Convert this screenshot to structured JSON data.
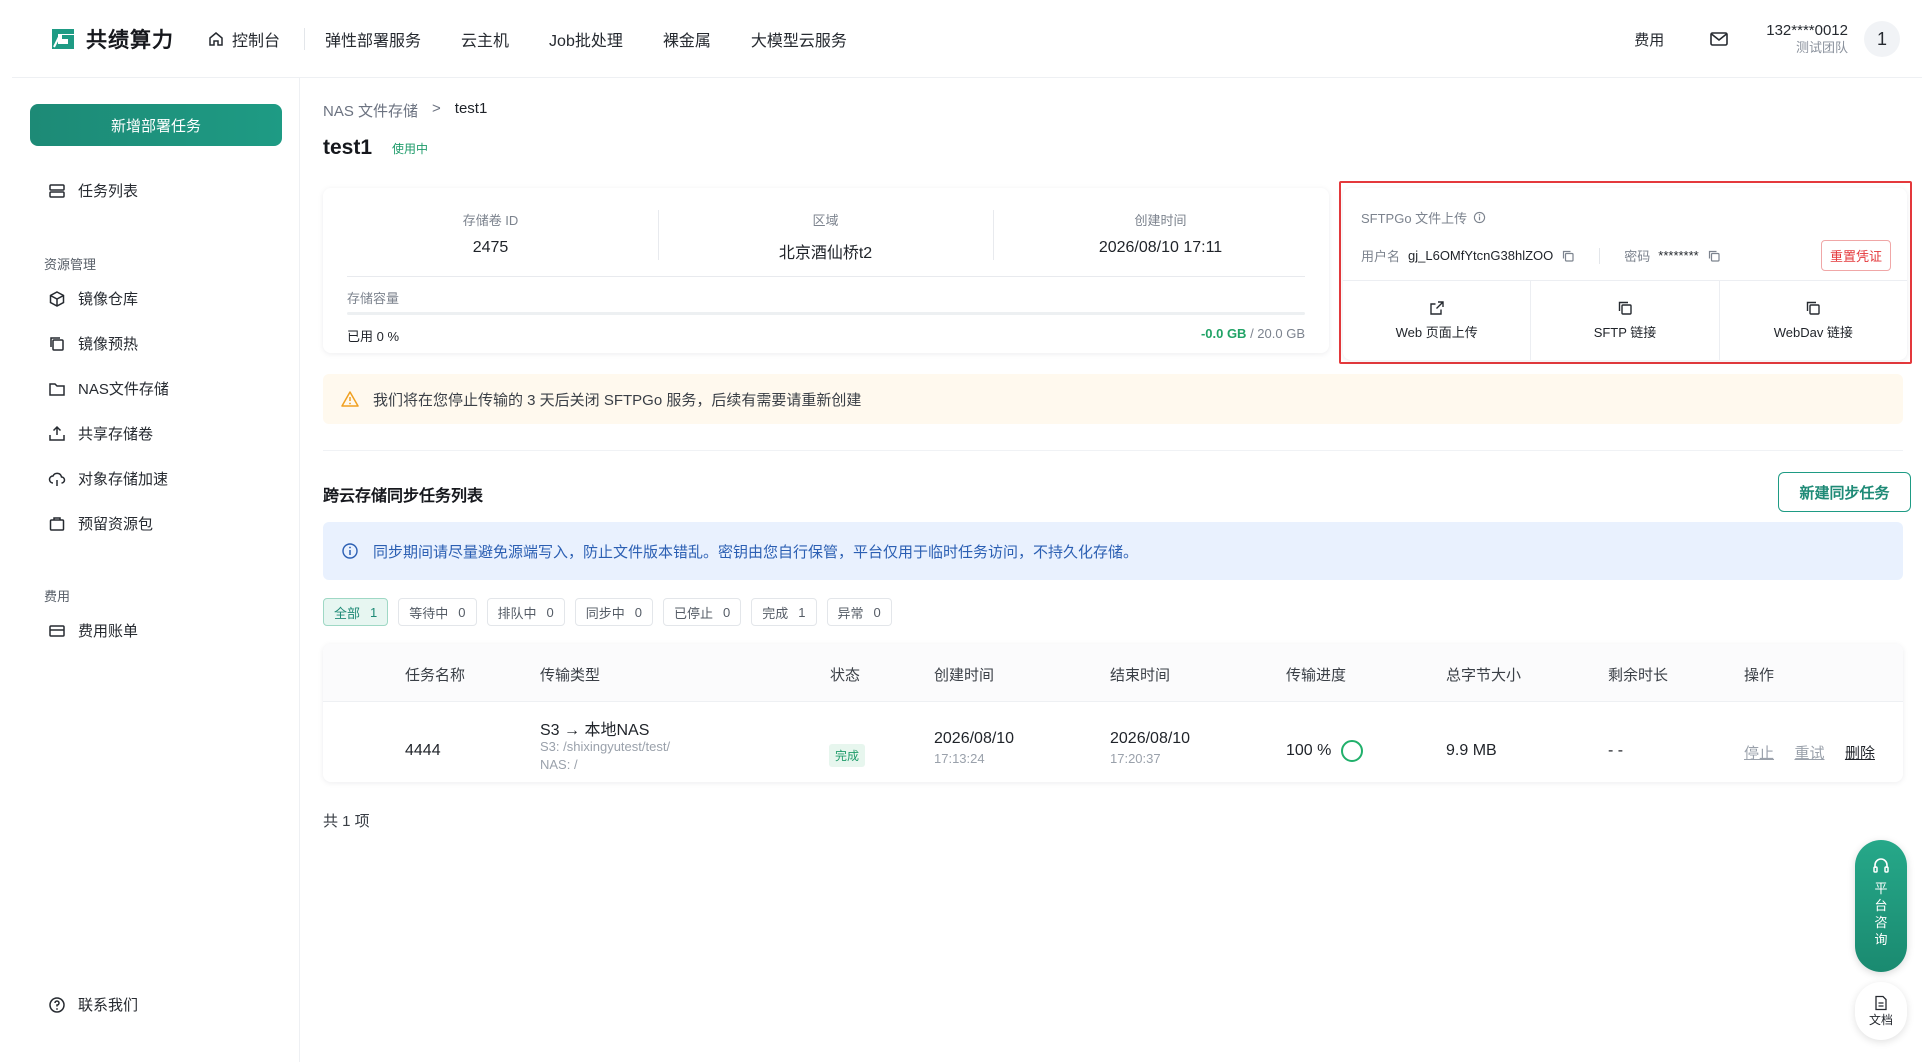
{
  "brand": {
    "name": "共绩算力",
    "accent": "#1e9b84"
  },
  "nav": {
    "console": "控制台",
    "items": [
      "弹性部署服务",
      "云主机",
      "Job批处理",
      "裸金属",
      "大模型云服务"
    ],
    "fee": "费用",
    "user_phone": "132****0012",
    "user_team": "测试团队",
    "avatar": "1"
  },
  "sidebar": {
    "new_task": "新增部署任务",
    "task_list": "任务列表",
    "group_resource": "资源管理",
    "resource_items": [
      "镜像仓库",
      "镜像预热",
      "NAS文件存储",
      "共享存储卷",
      "对象存储加速",
      "预留资源包"
    ],
    "group_fee": "费用",
    "fee_items": [
      "费用账单"
    ],
    "contact": "联系我们"
  },
  "breadcrumb": {
    "parent": "NAS 文件存储",
    "sep": ">",
    "current": "test1"
  },
  "page": {
    "title": "test1",
    "status": "使用中"
  },
  "storage": {
    "id_label": "存储卷 ID",
    "id": "2475",
    "region_label": "区域",
    "region": "北京酒仙桥t2",
    "created_label": "创建时间",
    "created": "2026/08/10 17:11",
    "capacity_label": "存储容量",
    "used": "已用 0 %",
    "used_gb": "-0.0 GB",
    "total_gb": "/ 20.0 GB",
    "used_fraction": 0
  },
  "sftp": {
    "title": "SFTPGo 文件上传",
    "user_label": "用户名",
    "user": "gj_L6OMfYtcnG38hlZOO",
    "pwd_label": "密码",
    "pwd": "********",
    "reset": "重置凭证",
    "actions": [
      "Web 页面上传",
      "SFTP 链接",
      "WebDav 链接"
    ]
  },
  "warning": "我们将在您停止传输的 3 天后关闭 SFTPGo 服务，后续有需要请重新创建",
  "sync": {
    "title": "跨云存储同步任务列表",
    "new_button": "新建同步任务",
    "info": "同步期间请尽量避免源端写入，防止文件版本错乱。密钥由您自行保管，平台仅用于临时任务访问，不持久化存储。",
    "filters": [
      {
        "label": "全部",
        "count": "1"
      },
      {
        "label": "等待中",
        "count": "0"
      },
      {
        "label": "排队中",
        "count": "0"
      },
      {
        "label": "同步中",
        "count": "0"
      },
      {
        "label": "已停止",
        "count": "0"
      },
      {
        "label": "完成",
        "count": "1"
      },
      {
        "label": "异常",
        "count": "0"
      }
    ],
    "columns": [
      "任务名称",
      "传输类型",
      "状态",
      "创建时间",
      "结束时间",
      "传输进度",
      "总字节大小",
      "剩余时长",
      "操作"
    ],
    "rows": [
      {
        "name": "4444",
        "type": "S3 → 本地NAS",
        "src": "S3: /shixingyutest/test/",
        "dst": "NAS: /",
        "status": "完成",
        "created_date": "2026/08/10",
        "created_time": "17:13:24",
        "ended_date": "2026/08/10",
        "ended_time": "17:20:37",
        "progress": "100 %",
        "size": "9.9 MB",
        "remaining": "- -",
        "ops": [
          "停止",
          "重试",
          "删除"
        ]
      }
    ],
    "total": "共 1 项"
  },
  "float": {
    "consult": [
      "平",
      "台",
      "咨",
      "询"
    ],
    "doc": "文档"
  }
}
